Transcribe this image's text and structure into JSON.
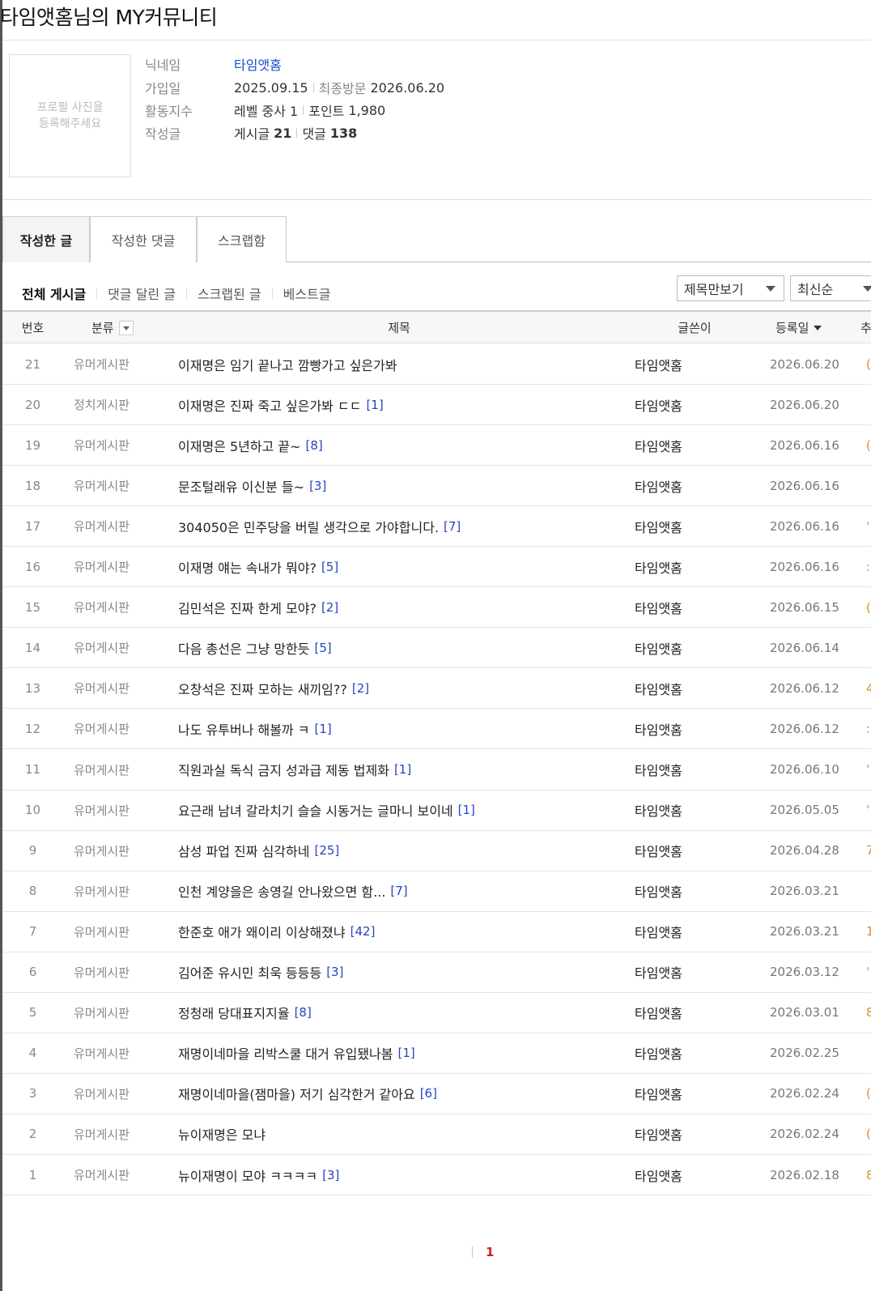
{
  "page_title": "타임앳홈님의 MY커뮤니티",
  "profile": {
    "photo_placeholder": "프로필 사진을\n등록해주세요",
    "nickname_label": "닉네임",
    "nickname": "타임앳홈",
    "joined_label": "가입일",
    "joined": "2025.09.15",
    "last_visit_label": "최종방문",
    "last_visit": "2026.06.20",
    "activity_label": "활동지수",
    "level": "레벨 중사 1",
    "points_label": "포인트",
    "points": "1,980",
    "posts_label": "작성글",
    "post_count_label": "게시글",
    "post_count": "21",
    "comment_count_label": "댓글",
    "comment_count": "138"
  },
  "tabs": [
    "작성한 글",
    "작성한 댓글",
    "스크랩함"
  ],
  "subnav": [
    "전체 게시글",
    "댓글 달린 글",
    "스크랩된 글",
    "베스트글"
  ],
  "view_select": "제목만보기",
  "sort_select": "최신순",
  "table": {
    "headers": {
      "num": "번호",
      "category": "분류",
      "title": "제목",
      "author": "글쓴이",
      "date": "등록일",
      "views": "추"
    },
    "rows": [
      {
        "num": "21",
        "category": "유머게시판",
        "title": "이재명은 임기 끝나고 깜빵가고 싶은가봐",
        "comments": "",
        "author": "타임앳홈",
        "date": "2026.06.20",
        "views": "("
      },
      {
        "num": "20",
        "category": "정치게시판",
        "title": "이재명은 진짜 죽고 싶은가봐 ㄷㄷ",
        "comments": "[1]",
        "author": "타임앳홈",
        "date": "2026.06.20",
        "views": ""
      },
      {
        "num": "19",
        "category": "유머게시판",
        "title": "이재명은 5년하고 끝~",
        "comments": "[8]",
        "author": "타임앳홈",
        "date": "2026.06.16",
        "views": "("
      },
      {
        "num": "18",
        "category": "유머게시판",
        "title": "문조털래유 이신분 들~",
        "comments": "[3]",
        "author": "타임앳홈",
        "date": "2026.06.16",
        "views": ""
      },
      {
        "num": "17",
        "category": "유머게시판",
        "title": "304050은 민주당을 버릴 생각으로 가야합니다.",
        "comments": "[7]",
        "author": "타임앳홈",
        "date": "2026.06.16",
        "views": "'"
      },
      {
        "num": "16",
        "category": "유머게시판",
        "title": "이재명 얘는 속내가 뭐야?",
        "comments": "[5]",
        "author": "타임앳홈",
        "date": "2026.06.16",
        "views": ":"
      },
      {
        "num": "15",
        "category": "유머게시판",
        "title": "김민석은 진짜 한게 모야?",
        "comments": "[2]",
        "author": "타임앳홈",
        "date": "2026.06.15",
        "views": "("
      },
      {
        "num": "14",
        "category": "유머게시판",
        "title": "다음 총선은 그냥 망한듯",
        "comments": "[5]",
        "author": "타임앳홈",
        "date": "2026.06.14",
        "views": ""
      },
      {
        "num": "13",
        "category": "유머게시판",
        "title": "오창석은 진짜 모하는 새끼임??",
        "comments": "[2]",
        "author": "타임앳홈",
        "date": "2026.06.12",
        "views": "4"
      },
      {
        "num": "12",
        "category": "유머게시판",
        "title": "나도 유투버나 해볼까 ㅋ",
        "comments": "[1]",
        "author": "타임앳홈",
        "date": "2026.06.12",
        "views": ":"
      },
      {
        "num": "11",
        "category": "유머게시판",
        "title": "직원과실 독식 금지 성과급 제동 법제화",
        "comments": "[1]",
        "author": "타임앳홈",
        "date": "2026.06.10",
        "views": "'"
      },
      {
        "num": "10",
        "category": "유머게시판",
        "title": "요근래 남녀 갈라치기 슬슬 시동거는 글마니 보이네",
        "comments": "[1]",
        "author": "타임앳홈",
        "date": "2026.05.05",
        "views": "'"
      },
      {
        "num": "9",
        "category": "유머게시판",
        "title": "삼성 파업 진짜 심각하네",
        "comments": "[25]",
        "author": "타임앳홈",
        "date": "2026.04.28",
        "views": "7"
      },
      {
        "num": "8",
        "category": "유머게시판",
        "title": "인천 계양을은 송영길 안나왔으면 함...",
        "comments": "[7]",
        "author": "타임앳홈",
        "date": "2026.03.21",
        "views": ""
      },
      {
        "num": "7",
        "category": "유머게시판",
        "title": "한준호 애가 왜이리 이상해졌냐",
        "comments": "[42]",
        "author": "타임앳홈",
        "date": "2026.03.21",
        "views": "1"
      },
      {
        "num": "6",
        "category": "유머게시판",
        "title": "김어준 유시민 최욱 등등등",
        "comments": "[3]",
        "author": "타임앳홈",
        "date": "2026.03.12",
        "views": "'"
      },
      {
        "num": "5",
        "category": "유머게시판",
        "title": "정청래 당대표지지율",
        "comments": "[8]",
        "author": "타임앳홈",
        "date": "2026.03.01",
        "views": "8"
      },
      {
        "num": "4",
        "category": "유머게시판",
        "title": "재명이네마을 리박스쿨 대거 유입됐나봄",
        "comments": "[1]",
        "author": "타임앳홈",
        "date": "2026.02.25",
        "views": ""
      },
      {
        "num": "3",
        "category": "유머게시판",
        "title": "재명이네마을(잼마을) 저기 심각한거 같아요",
        "comments": "[6]",
        "author": "타임앳홈",
        "date": "2026.02.24",
        "views": "("
      },
      {
        "num": "2",
        "category": "유머게시판",
        "title": "뉴이재명은 모냐",
        "comments": "",
        "author": "타임앳홈",
        "date": "2026.02.24",
        "views": "("
      },
      {
        "num": "1",
        "category": "유머게시판",
        "title": "뉴이재명이 모야 ㅋㅋㅋㅋ",
        "comments": "[3]",
        "author": "타임앳홈",
        "date": "2026.02.18",
        "views": "8"
      }
    ]
  },
  "pagination": {
    "current": "1"
  }
}
